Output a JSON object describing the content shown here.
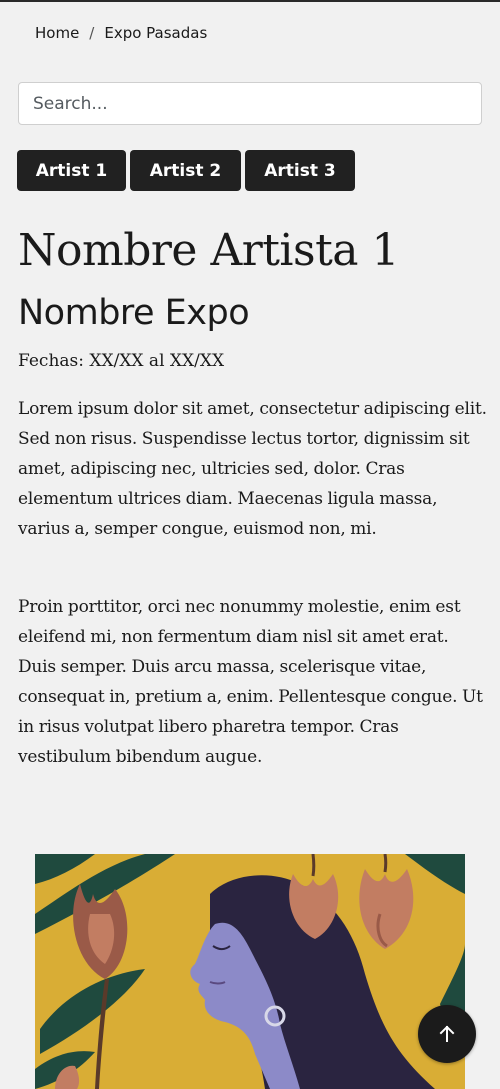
{
  "breadcrumb": {
    "home": "Home",
    "separator": "/",
    "current": "Expo Pasadas"
  },
  "search": {
    "placeholder": "Search...",
    "value": ""
  },
  "artists": [
    {
      "label": "Artist 1"
    },
    {
      "label": "Artist 2"
    },
    {
      "label": "Artist 3"
    }
  ],
  "main": {
    "artist_name": "Nombre Artista 1",
    "expo_name": "Nombre Expo",
    "dates": "Fechas: XX/XX al XX/XX",
    "paragraphs": [
      "Lorem ipsum dolor sit amet, consectetur adipiscing elit. Sed non risus. Suspendisse lectus tortor, dignissim sit amet, adipiscing nec, ultricies sed, dolor. Cras elementum ultrices diam. Maecenas ligula massa, varius a, semper congue, euismod non, mi.",
      "Proin porttitor, orci nec nonummy molestie, enim est eleifend mi, non fermentum diam nisl sit amet erat. Duis semper. Duis arcu massa, scelerisque vitae, consequat in, pretium a, enim. Pellentesque congue. Ut in risus volutpat libero pharetra tempor. Cras vestibulum bibendum augue."
    ]
  },
  "artwork": {
    "icon": "artwork-illustration",
    "colors": {
      "background": "#d9ad35",
      "leaf": "#1f4a3e",
      "flower": "#c27d62",
      "face": "#8c8ac8",
      "hair": "#2a2440"
    }
  },
  "back_to_top": {
    "icon": "arrow-up-icon"
  },
  "colors": {
    "page_background": "#f1f1f1",
    "button_background": "#212121",
    "button_text": "#ffffff",
    "text": "#1a1a1a"
  }
}
